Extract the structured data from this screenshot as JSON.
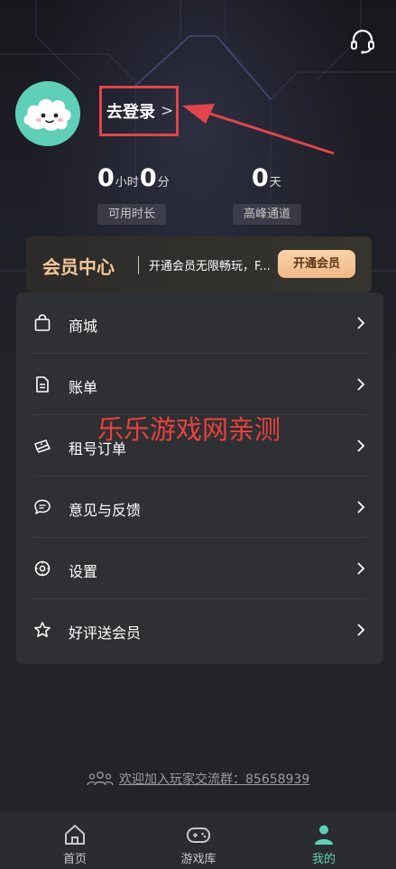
{
  "header": {
    "support_icon": "headset-icon",
    "login_label": "去登录",
    "login_chevron": ">"
  },
  "stats": {
    "hours_value": "0",
    "hours_unit": "小时",
    "minutes_value": "0",
    "minutes_unit": "分",
    "available_label": "可用时长",
    "days_value": "0",
    "days_unit": "天",
    "peak_label": "高峰通道"
  },
  "vip": {
    "title": "会员中心",
    "description": "开通会员无限畅玩，F...",
    "button_label": "开通会员"
  },
  "menu": {
    "items": [
      {
        "label": "商城",
        "icon": "shopping-bag-icon"
      },
      {
        "label": "账单",
        "icon": "bill-icon"
      },
      {
        "label": "租号订单",
        "icon": "ticket-icon"
      },
      {
        "label": "意见与反馈",
        "icon": "chat-bubble-icon"
      },
      {
        "label": "设置",
        "icon": "settings-icon"
      },
      {
        "label": "好评送会员",
        "icon": "star-icon"
      }
    ]
  },
  "watermark": "乐乐游戏网亲测",
  "community": {
    "text": "欢迎加入玩家交流群：85658939",
    "icon": "group-icon"
  },
  "tabbar": {
    "items": [
      {
        "label": "首页",
        "icon": "home-icon"
      },
      {
        "label": "游戏库",
        "icon": "gamepad-icon"
      },
      {
        "label": "我的",
        "icon": "person-icon"
      }
    ],
    "active_index": 2
  },
  "colors": {
    "accent": "#5ed0b5",
    "highlight_red": "#e0454b",
    "vip_gold": "#f3c89a"
  }
}
